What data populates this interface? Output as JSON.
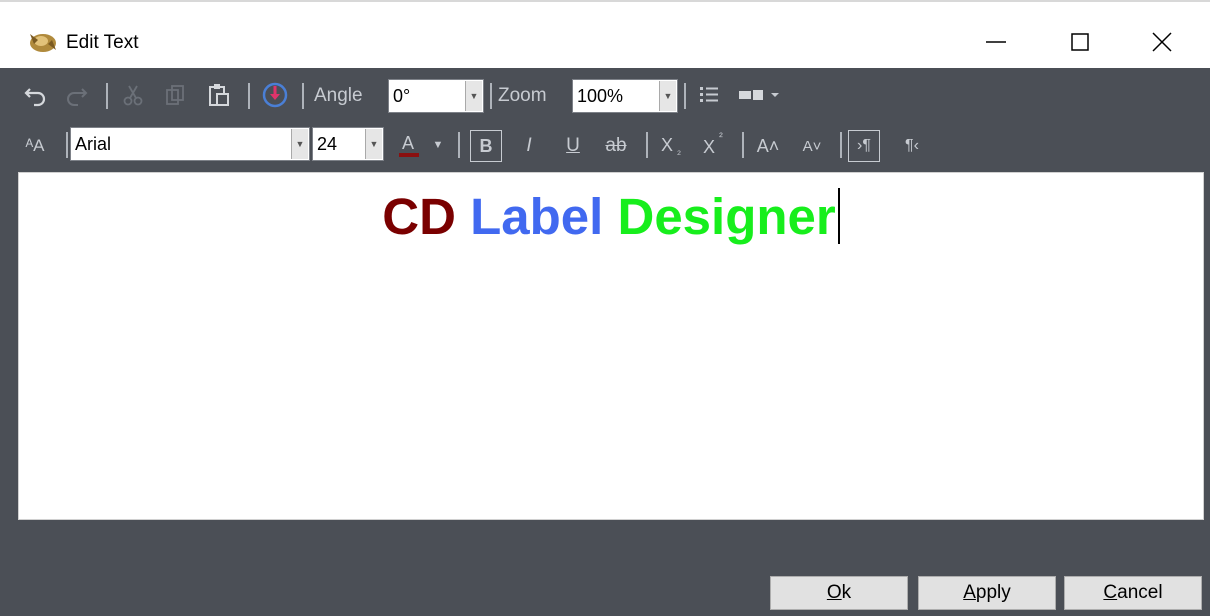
{
  "window": {
    "title": "Edit Text"
  },
  "toolbar1": {
    "angle_label": "Angle",
    "angle_value": "0°",
    "zoom_label": "Zoom",
    "zoom_value": "100%"
  },
  "toolbar2": {
    "font_name": "Arial",
    "font_size": "24",
    "bold": "B",
    "italic": "I",
    "underline": "U",
    "strikethrough": "ab",
    "subscript": "X",
    "superscript": "X",
    "text_color": "#8b1010"
  },
  "editor": {
    "words": [
      {
        "text": "CD",
        "color": "#7a0000"
      },
      {
        "text": "Label",
        "color": "#4169f0"
      },
      {
        "text": "Designer",
        "color": "#17ee1c"
      }
    ]
  },
  "buttons": {
    "ok": {
      "mnemonic": "O",
      "rest": "k"
    },
    "apply": {
      "mnemonic": "A",
      "rest": "pply"
    },
    "cancel": {
      "mnemonic": "C",
      "rest": "ancel"
    }
  },
  "icons": [
    "app-icon",
    "undo-icon",
    "redo-icon",
    "cut-icon",
    "copy-icon",
    "paste-icon",
    "rotate-icon",
    "list-icon",
    "layout-icon",
    "font-size-icon",
    "font-color-icon",
    "grow-font-icon",
    "shrink-font-icon",
    "ltr-icon",
    "rtl-icon",
    "minimize-icon",
    "maximize-icon",
    "close-icon"
  ]
}
